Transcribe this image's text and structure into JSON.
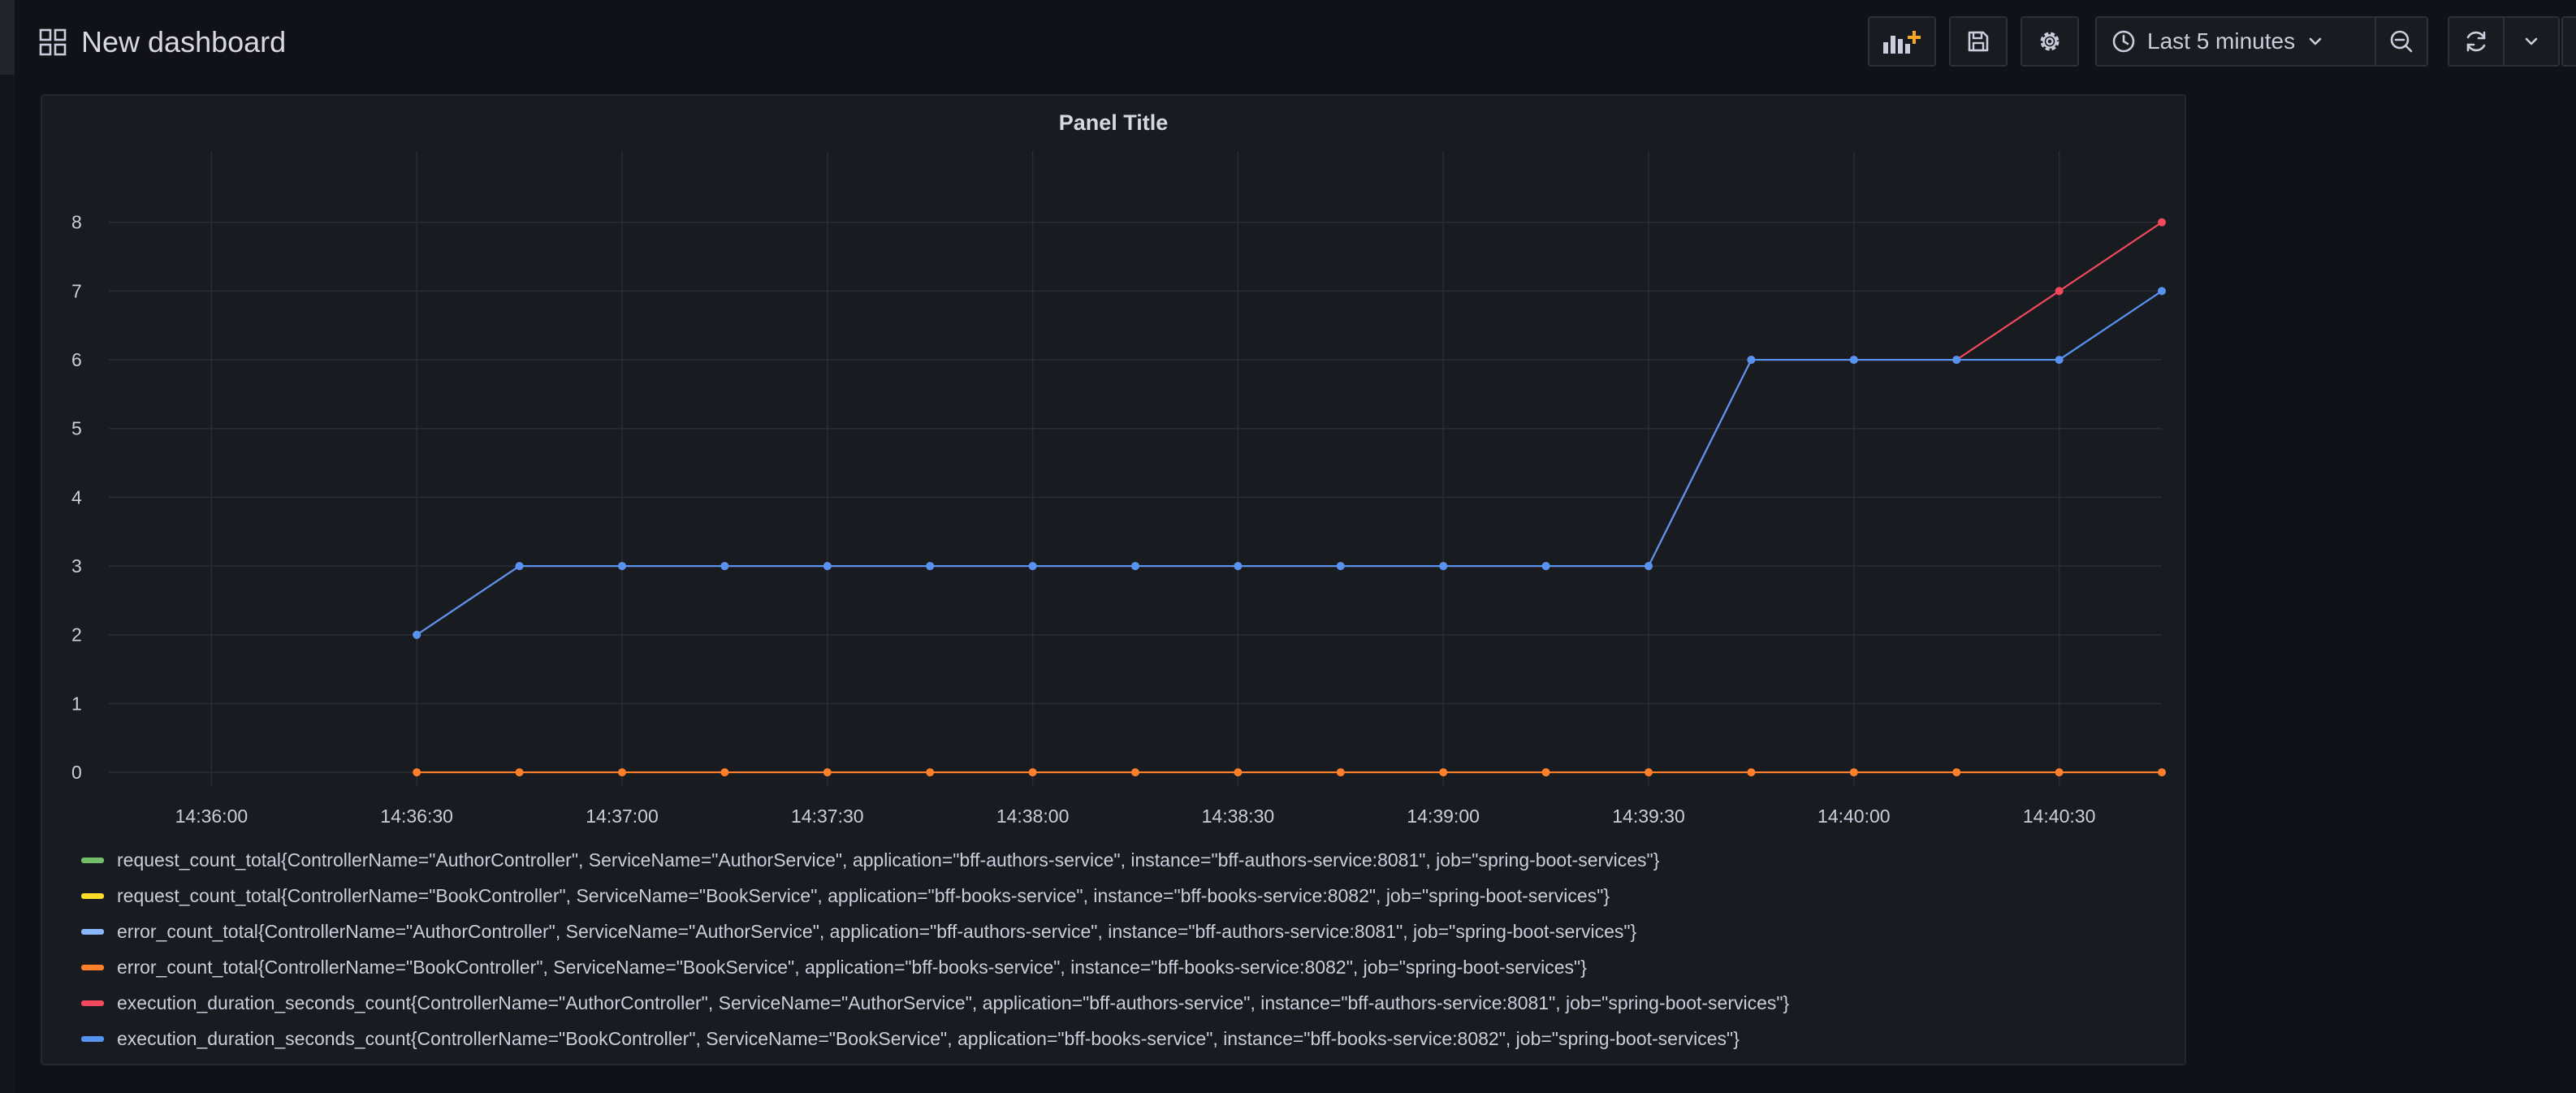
{
  "header": {
    "title": "New dashboard",
    "time_range": "Last 5 minutes",
    "icons": [
      "grid-icon",
      "add-panel-icon",
      "save-icon",
      "gear-icon",
      "clock-icon",
      "chevron-down-icon",
      "zoom-out-icon",
      "refresh-icon",
      "chevron-down-icon"
    ]
  },
  "panel": {
    "title": "Panel Title"
  },
  "chart_data": {
    "type": "line",
    "title": "Panel Title",
    "x_ticks": [
      "14:36:00",
      "14:36:30",
      "14:37:00",
      "14:37:30",
      "14:38:00",
      "14:38:30",
      "14:39:00",
      "14:39:30",
      "14:40:00",
      "14:40:30"
    ],
    "y_ticks": [
      "0",
      "1",
      "2",
      "3",
      "4",
      "5",
      "6",
      "7",
      "8"
    ],
    "ylim": [
      -0.2,
      8.8
    ],
    "xlim": [
      "14:35:45",
      "14:40:45"
    ],
    "grid": true,
    "legend_position": "bottom",
    "x": [
      "14:36:30",
      "14:36:45",
      "14:37:00",
      "14:37:15",
      "14:37:30",
      "14:37:45",
      "14:38:00",
      "14:38:15",
      "14:38:30",
      "14:38:45",
      "14:39:00",
      "14:39:15",
      "14:39:30",
      "14:39:45",
      "14:40:00",
      "14:40:15",
      "14:40:30",
      "14:40:45"
    ],
    "series": [
      {
        "name": "request_count_total{ControllerName=\"AuthorController\", ServiceName=\"AuthorService\", application=\"bff-authors-service\", instance=\"bff-authors-service:8081\", job=\"spring-boot-services\"}",
        "color": "#73bf69",
        "values": []
      },
      {
        "name": "request_count_total{ControllerName=\"BookController\", ServiceName=\"BookService\", application=\"bff-books-service\", instance=\"bff-books-service:8082\", job=\"spring-boot-services\"}",
        "color": "#fade2a",
        "values": []
      },
      {
        "name": "error_count_total{ControllerName=\"AuthorController\", ServiceName=\"AuthorService\", application=\"bff-authors-service\", instance=\"bff-authors-service:8081\", job=\"spring-boot-services\"}",
        "color": "#8ab8ff",
        "values": []
      },
      {
        "name": "error_count_total{ControllerName=\"BookController\", ServiceName=\"BookService\", application=\"bff-books-service\", instance=\"bff-books-service:8082\", job=\"spring-boot-services\"}",
        "color": "#ff7f2a",
        "values": [
          0,
          0,
          0,
          0,
          0,
          0,
          0,
          0,
          0,
          0,
          0,
          0,
          0,
          0,
          0,
          0,
          0,
          0
        ]
      },
      {
        "name": "execution_duration_seconds_count{ControllerName=\"AuthorController\", ServiceName=\"AuthorService\", application=\"bff-authors-service\", instance=\"bff-authors-service:8081\", job=\"spring-boot-services\"}",
        "color": "#f2495c",
        "values": [
          2,
          3,
          3,
          3,
          3,
          3,
          3,
          3,
          3,
          3,
          3,
          3,
          3,
          6,
          6,
          6,
          7,
          8
        ]
      },
      {
        "name": "execution_duration_seconds_count{ControllerName=\"BookController\", ServiceName=\"BookService\", application=\"bff-books-service\", instance=\"bff-books-service:8082\", job=\"spring-boot-services\"}",
        "color": "#5794f2",
        "values": [
          2,
          3,
          3,
          3,
          3,
          3,
          3,
          3,
          3,
          3,
          3,
          3,
          3,
          6,
          6,
          6,
          6,
          7
        ]
      }
    ]
  }
}
